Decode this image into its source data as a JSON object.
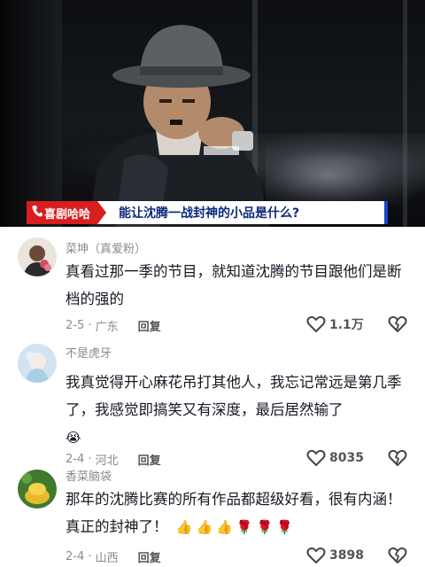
{
  "video": {
    "brand_tag": "喜剧哈哈",
    "caption": "能让沈腾一战封神的小品是什么?"
  },
  "comments": [
    {
      "username": "菜坤（真爱粉）",
      "text": "真看过那一季的节目，就知道沈腾的节目跟他们是断档的强的",
      "date": "2-5",
      "location": "广东",
      "reply_label": "回复",
      "likes": "1.1万"
    },
    {
      "username": "不是虎牙",
      "text": "我真觉得开心麻花吊打其他人，我忘记常远是第几季了，我感觉即搞笑又有深度，最后居然输了",
      "date": "2-4",
      "location": "河北",
      "reply_label": "回复",
      "likes": "8035"
    },
    {
      "username": "香菜脑袋",
      "text": "那年的沈腾比赛的所有作品都超级好看，很有内涵！真正的封神了！",
      "date": "2-4",
      "location": "山西",
      "reply_label": "回复",
      "likes": "3898"
    }
  ],
  "colors": {
    "brand_red": "#d81e1e",
    "caption_blue": "#0b2a7a",
    "muted": "#8a8b91"
  }
}
